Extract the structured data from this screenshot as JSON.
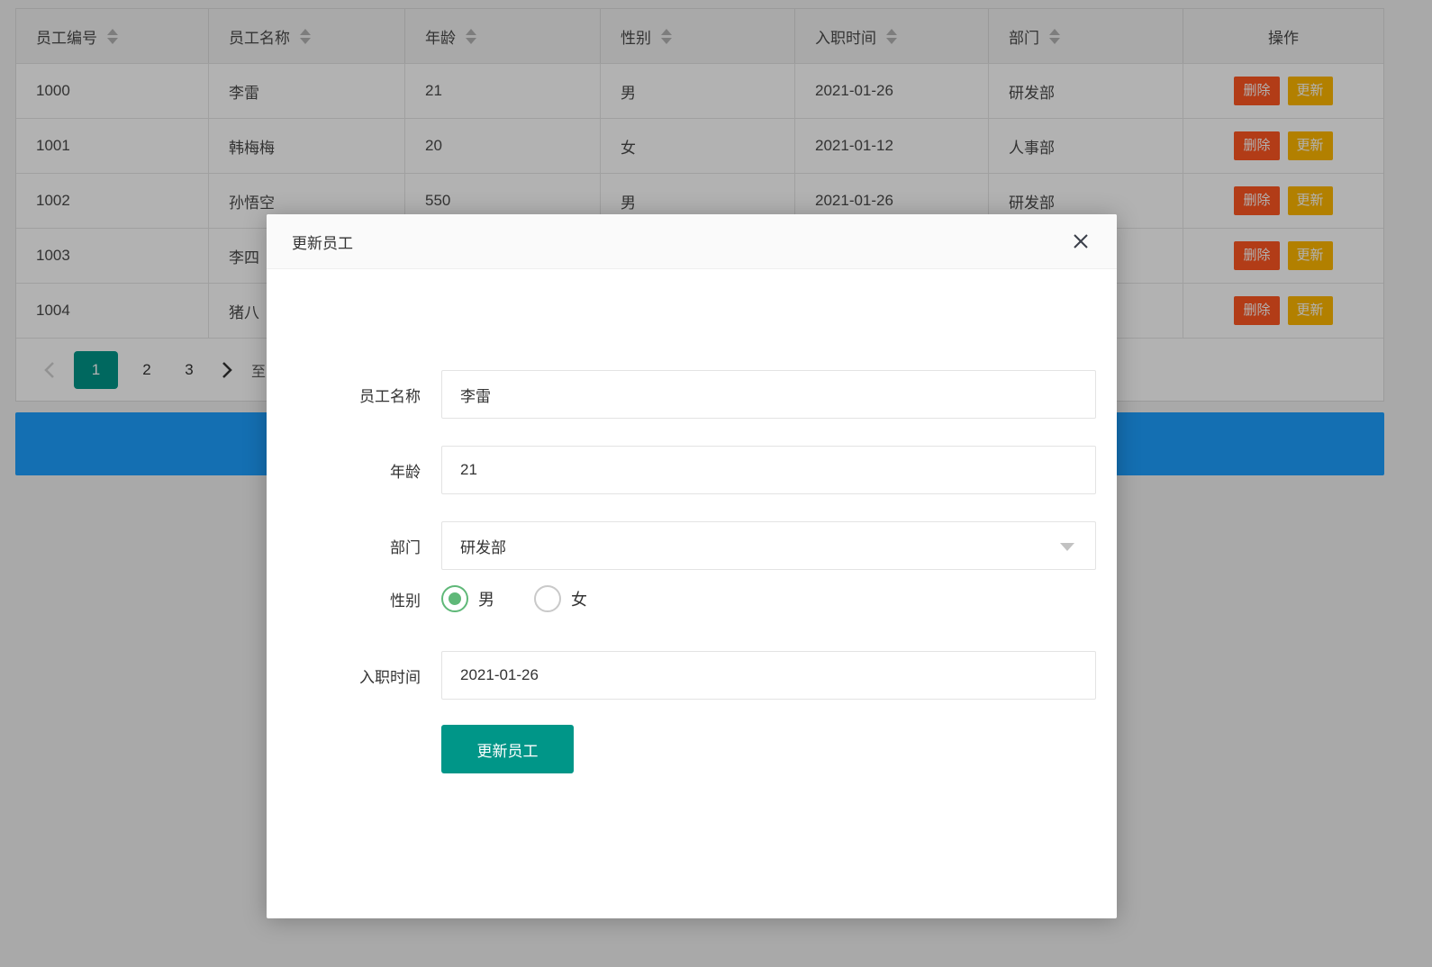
{
  "colors": {
    "primary_teal": "#009688",
    "primary_blue": "#1E9FFF",
    "danger_red": "#FF5722",
    "warning_orange": "#FFB800",
    "radio_green": "#5FB878"
  },
  "table": {
    "columns": [
      {
        "label": "员工编号",
        "sortable": true
      },
      {
        "label": "员工名称",
        "sortable": true
      },
      {
        "label": "年龄",
        "sortable": true
      },
      {
        "label": "性别",
        "sortable": true
      },
      {
        "label": "入职时间",
        "sortable": true
      },
      {
        "label": "部门",
        "sortable": true
      },
      {
        "label": "操作",
        "sortable": false
      }
    ],
    "rows": [
      {
        "id": "1000",
        "name": "李雷",
        "age": "21",
        "gender": "男",
        "hire_date": "2021-01-26",
        "department": "研发部"
      },
      {
        "id": "1001",
        "name": "韩梅梅",
        "age": "20",
        "gender": "女",
        "hire_date": "2021-01-12",
        "department": "人事部"
      },
      {
        "id": "1002",
        "name": "孙悟空",
        "age": "550",
        "gender": "男",
        "hire_date": "2021-01-26",
        "department": "研发部"
      },
      {
        "id": "1003",
        "name": "李四",
        "age": "",
        "gender": "",
        "hire_date": "",
        "department": ""
      },
      {
        "id": "1004",
        "name": "猪八",
        "age": "",
        "gender": "",
        "hire_date": "",
        "department": ""
      }
    ],
    "actions": {
      "delete_label": "删除",
      "update_label": "更新"
    }
  },
  "pagination": {
    "pages": [
      "1",
      "2",
      "3"
    ],
    "active_page": "1",
    "jump_text": "至"
  },
  "modal": {
    "title": "更新员工",
    "fields": {
      "name": {
        "label": "员工名称",
        "value": "李雷"
      },
      "age": {
        "label": "年龄",
        "value": "21"
      },
      "department": {
        "label": "部门",
        "value": "研发部"
      },
      "gender": {
        "label": "性别",
        "options": [
          "男",
          "女"
        ],
        "selected": "男"
      },
      "hire_date": {
        "label": "入职时间",
        "value": "2021-01-26"
      }
    },
    "submit_label": "更新员工"
  }
}
